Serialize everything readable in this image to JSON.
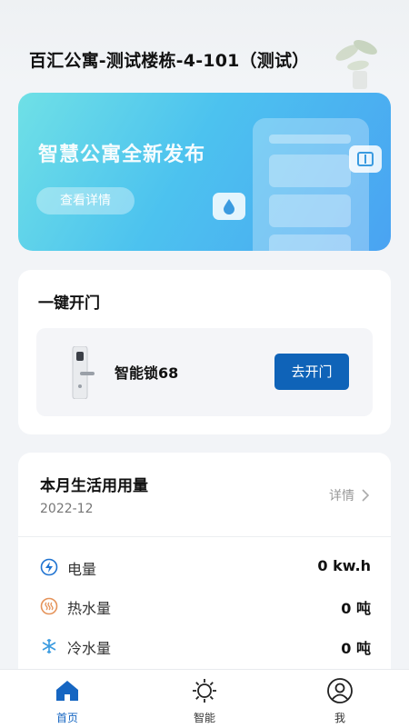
{
  "header": {
    "title": "百汇公寓-测试楼栋-4-101（测试）"
  },
  "banner": {
    "title": "智慧公寓全新发布",
    "button_label": "查看详情"
  },
  "unlock": {
    "title": "一键开门",
    "lock_name": "智能锁68",
    "open_label": "去开门"
  },
  "usage": {
    "title": "本月生活用用量",
    "month": "2022-12",
    "detail_label": "详情",
    "items": [
      {
        "label": "电量",
        "value": "0 kw.h",
        "icon": "lightning-icon"
      },
      {
        "label": "热水量",
        "value": "0 吨",
        "icon": "hot-water-icon"
      },
      {
        "label": "冷水量",
        "value": "0 吨",
        "icon": "snowflake-icon"
      }
    ]
  },
  "tabs": [
    {
      "label": "首页",
      "icon": "home-icon",
      "active": true
    },
    {
      "label": "智能",
      "icon": "sun-icon",
      "active": false
    },
    {
      "label": "我",
      "icon": "user-icon",
      "active": false
    }
  ],
  "colors": {
    "accent": "#1666c2",
    "button": "#0f63b8",
    "background": "#f2f4f7"
  }
}
